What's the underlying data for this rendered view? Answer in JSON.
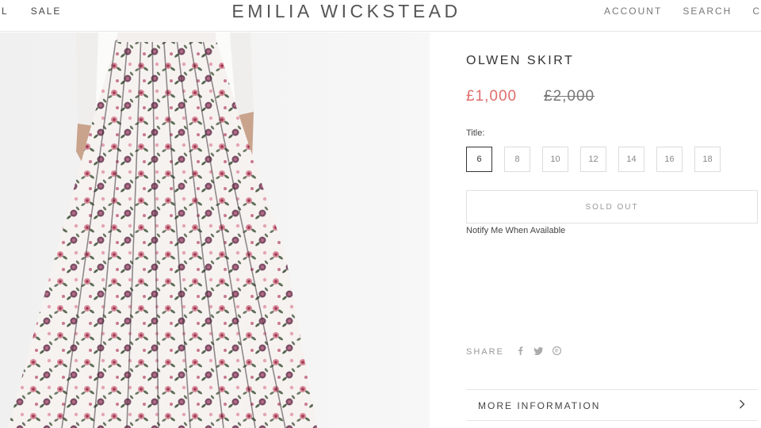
{
  "header": {
    "nav_left": [
      "AL",
      "SALE"
    ],
    "logo": "EMILIA WICKSTEAD",
    "nav_right": [
      "ACCOUNT",
      "SEARCH",
      "CA"
    ]
  },
  "product": {
    "title": "OLWEN SKIRT",
    "price": "£1,000",
    "old_price": "£2,000",
    "size_label": "Title:",
    "sizes": [
      "6",
      "8",
      "10",
      "12",
      "14",
      "16",
      "18"
    ],
    "selected_size": "6",
    "sold_out_label": "SOLD OUT",
    "notify_link": "Notify Me When Available",
    "share_label": "SHARE",
    "share_icons": [
      "facebook-icon",
      "twitter-icon",
      "pinterest-icon"
    ],
    "more_info_label": "MORE INFORMATION"
  },
  "colors": {
    "sale_price": "#e06d6d",
    "text": "#333333",
    "border": "#e0e0e0"
  }
}
